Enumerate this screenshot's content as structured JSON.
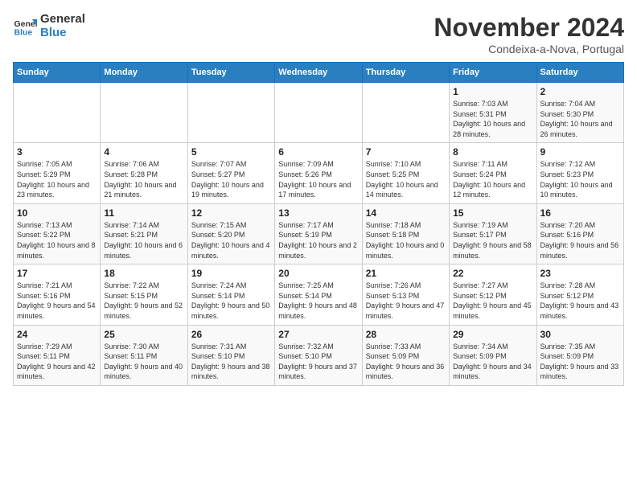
{
  "logo": {
    "line1": "General",
    "line2": "Blue"
  },
  "title": "November 2024",
  "location": "Condeixa-a-Nova, Portugal",
  "weekdays": [
    "Sunday",
    "Monday",
    "Tuesday",
    "Wednesday",
    "Thursday",
    "Friday",
    "Saturday"
  ],
  "weeks": [
    [
      {
        "day": "",
        "info": ""
      },
      {
        "day": "",
        "info": ""
      },
      {
        "day": "",
        "info": ""
      },
      {
        "day": "",
        "info": ""
      },
      {
        "day": "",
        "info": ""
      },
      {
        "day": "1",
        "info": "Sunrise: 7:03 AM\nSunset: 5:31 PM\nDaylight: 10 hours and 28 minutes."
      },
      {
        "day": "2",
        "info": "Sunrise: 7:04 AM\nSunset: 5:30 PM\nDaylight: 10 hours and 26 minutes."
      }
    ],
    [
      {
        "day": "3",
        "info": "Sunrise: 7:05 AM\nSunset: 5:29 PM\nDaylight: 10 hours and 23 minutes."
      },
      {
        "day": "4",
        "info": "Sunrise: 7:06 AM\nSunset: 5:28 PM\nDaylight: 10 hours and 21 minutes."
      },
      {
        "day": "5",
        "info": "Sunrise: 7:07 AM\nSunset: 5:27 PM\nDaylight: 10 hours and 19 minutes."
      },
      {
        "day": "6",
        "info": "Sunrise: 7:09 AM\nSunset: 5:26 PM\nDaylight: 10 hours and 17 minutes."
      },
      {
        "day": "7",
        "info": "Sunrise: 7:10 AM\nSunset: 5:25 PM\nDaylight: 10 hours and 14 minutes."
      },
      {
        "day": "8",
        "info": "Sunrise: 7:11 AM\nSunset: 5:24 PM\nDaylight: 10 hours and 12 minutes."
      },
      {
        "day": "9",
        "info": "Sunrise: 7:12 AM\nSunset: 5:23 PM\nDaylight: 10 hours and 10 minutes."
      }
    ],
    [
      {
        "day": "10",
        "info": "Sunrise: 7:13 AM\nSunset: 5:22 PM\nDaylight: 10 hours and 8 minutes."
      },
      {
        "day": "11",
        "info": "Sunrise: 7:14 AM\nSunset: 5:21 PM\nDaylight: 10 hours and 6 minutes."
      },
      {
        "day": "12",
        "info": "Sunrise: 7:15 AM\nSunset: 5:20 PM\nDaylight: 10 hours and 4 minutes."
      },
      {
        "day": "13",
        "info": "Sunrise: 7:17 AM\nSunset: 5:19 PM\nDaylight: 10 hours and 2 minutes."
      },
      {
        "day": "14",
        "info": "Sunrise: 7:18 AM\nSunset: 5:18 PM\nDaylight: 10 hours and 0 minutes."
      },
      {
        "day": "15",
        "info": "Sunrise: 7:19 AM\nSunset: 5:17 PM\nDaylight: 9 hours and 58 minutes."
      },
      {
        "day": "16",
        "info": "Sunrise: 7:20 AM\nSunset: 5:16 PM\nDaylight: 9 hours and 56 minutes."
      }
    ],
    [
      {
        "day": "17",
        "info": "Sunrise: 7:21 AM\nSunset: 5:16 PM\nDaylight: 9 hours and 54 minutes."
      },
      {
        "day": "18",
        "info": "Sunrise: 7:22 AM\nSunset: 5:15 PM\nDaylight: 9 hours and 52 minutes."
      },
      {
        "day": "19",
        "info": "Sunrise: 7:24 AM\nSunset: 5:14 PM\nDaylight: 9 hours and 50 minutes."
      },
      {
        "day": "20",
        "info": "Sunrise: 7:25 AM\nSunset: 5:14 PM\nDaylight: 9 hours and 48 minutes."
      },
      {
        "day": "21",
        "info": "Sunrise: 7:26 AM\nSunset: 5:13 PM\nDaylight: 9 hours and 47 minutes."
      },
      {
        "day": "22",
        "info": "Sunrise: 7:27 AM\nSunset: 5:12 PM\nDaylight: 9 hours and 45 minutes."
      },
      {
        "day": "23",
        "info": "Sunrise: 7:28 AM\nSunset: 5:12 PM\nDaylight: 9 hours and 43 minutes."
      }
    ],
    [
      {
        "day": "24",
        "info": "Sunrise: 7:29 AM\nSunset: 5:11 PM\nDaylight: 9 hours and 42 minutes."
      },
      {
        "day": "25",
        "info": "Sunrise: 7:30 AM\nSunset: 5:11 PM\nDaylight: 9 hours and 40 minutes."
      },
      {
        "day": "26",
        "info": "Sunrise: 7:31 AM\nSunset: 5:10 PM\nDaylight: 9 hours and 38 minutes."
      },
      {
        "day": "27",
        "info": "Sunrise: 7:32 AM\nSunset: 5:10 PM\nDaylight: 9 hours and 37 minutes."
      },
      {
        "day": "28",
        "info": "Sunrise: 7:33 AM\nSunset: 5:09 PM\nDaylight: 9 hours and 36 minutes."
      },
      {
        "day": "29",
        "info": "Sunrise: 7:34 AM\nSunset: 5:09 PM\nDaylight: 9 hours and 34 minutes."
      },
      {
        "day": "30",
        "info": "Sunrise: 7:35 AM\nSunset: 5:09 PM\nDaylight: 9 hours and 33 minutes."
      }
    ]
  ]
}
